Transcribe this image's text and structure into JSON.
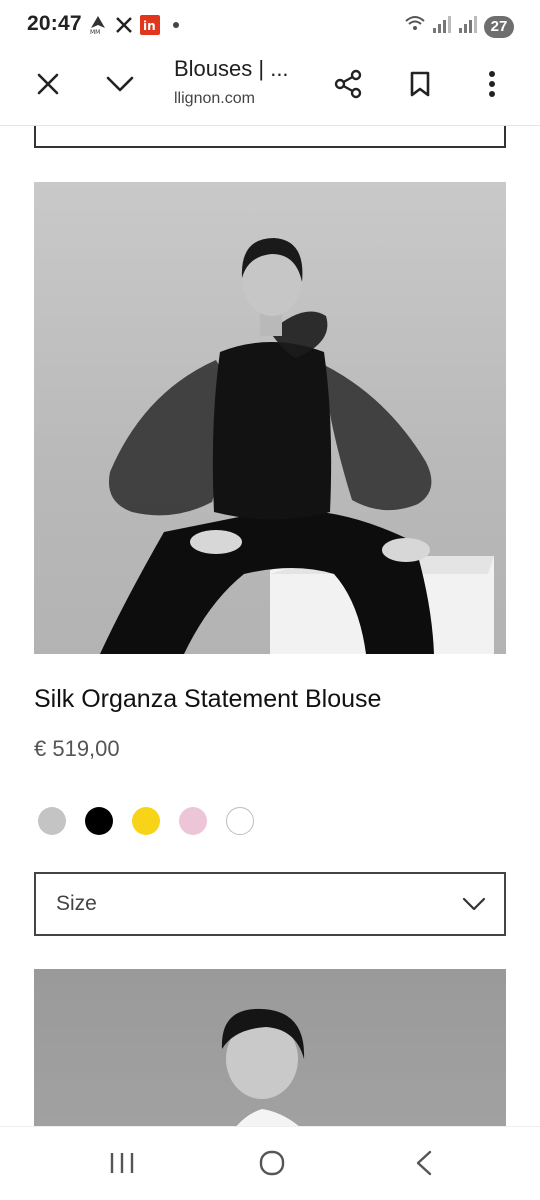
{
  "status_bar": {
    "time": "20:47",
    "notification_icons": [
      "nav-arrow-icon",
      "x-logo-icon",
      "linkedin-icon",
      "dot-icon"
    ],
    "battery": "27"
  },
  "toolbar": {
    "title": "Blouses | ...",
    "url": "llignon.com"
  },
  "product": {
    "name": "Silk Organza Statement Blouse",
    "price": "€ 519,00",
    "colors": [
      {
        "name": "grey",
        "hex": "#c4c4c4"
      },
      {
        "name": "black",
        "hex": "#000000"
      },
      {
        "name": "yellow",
        "hex": "#f7d417"
      },
      {
        "name": "pink",
        "hex": "#ecc6d6"
      },
      {
        "name": "white",
        "hex": "#ffffff"
      }
    ],
    "size_label": "Size"
  },
  "nav_bar": {
    "buttons": [
      "recent-apps",
      "home",
      "back"
    ]
  }
}
